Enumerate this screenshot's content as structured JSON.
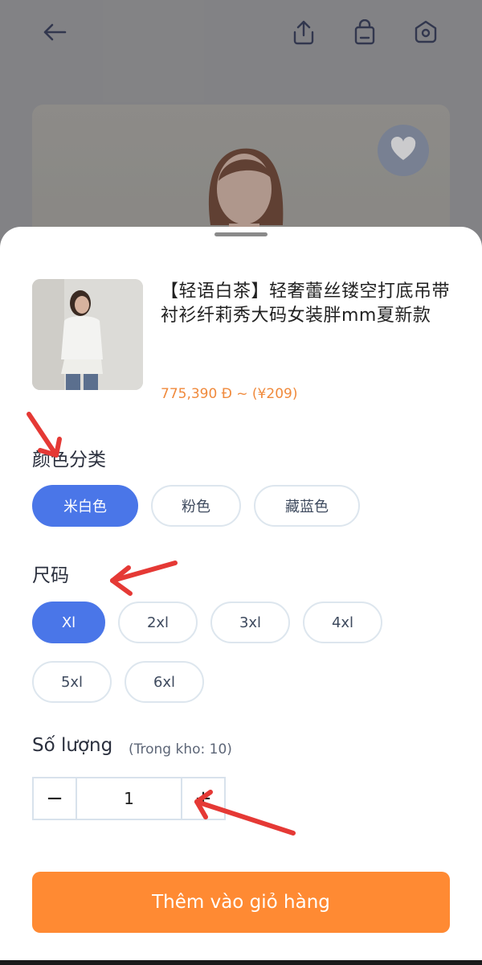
{
  "header": {
    "icons": [
      "back-arrow-icon",
      "share-icon",
      "shopping-bag-icon",
      "home-icon"
    ]
  },
  "hero": {
    "favorite_icon": "heart-icon"
  },
  "product": {
    "title": "【轻语白茶】轻奢蕾丝镂空打底吊带衬衫纤莉秀大码女装胖mm夏新款",
    "price": "775,390 Đ ~ (¥209)"
  },
  "color_section": {
    "label": "颜色分类",
    "options": [
      "米白色",
      "粉色",
      "藏蓝色"
    ],
    "selected": "米白色"
  },
  "size_section": {
    "label": "尺码",
    "options": [
      "Xl",
      "2xl",
      "3xl",
      "4xl",
      "5xl",
      "6xl"
    ],
    "selected": "Xl"
  },
  "quantity": {
    "label": "Số lượng",
    "stock": "(Trong kho: 10)",
    "minus": "−",
    "value": "1",
    "plus": "+"
  },
  "cta": {
    "label": "Thêm vào giỏ hàng"
  },
  "colors": {
    "accent": "#4a76e8",
    "cta": "#ff8a33",
    "price": "#f08a3c",
    "annotation": "#e53935"
  }
}
